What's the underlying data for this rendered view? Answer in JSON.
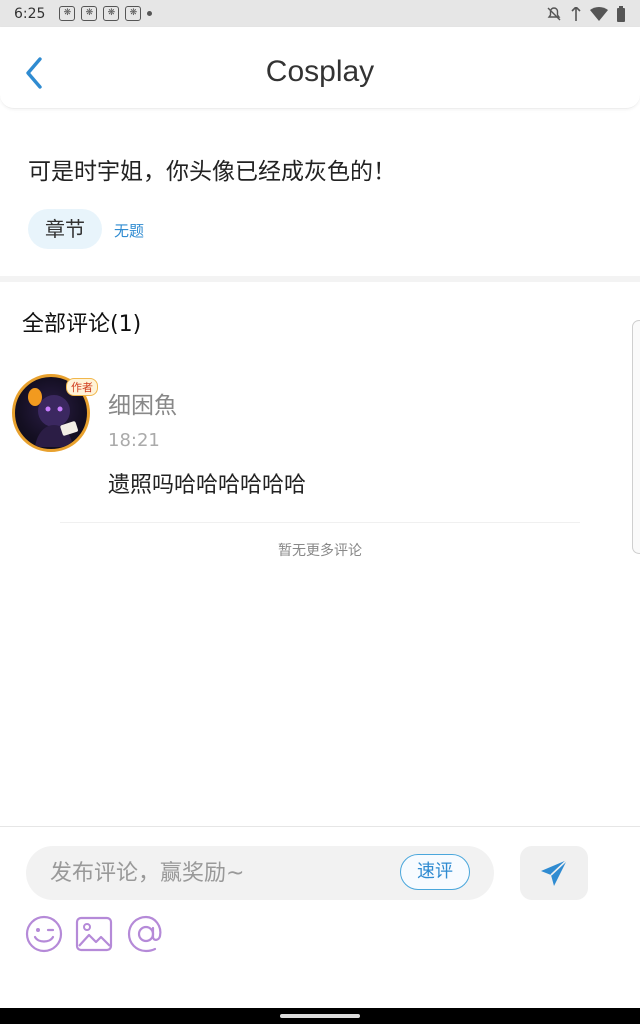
{
  "status_bar": {
    "time": "6:25",
    "notification_icons": [
      "paw-notification-icon",
      "paw-notification-icon",
      "paw-notification-icon",
      "paw-notification-icon"
    ]
  },
  "header": {
    "title": "Cosplay"
  },
  "post": {
    "text": "可是时宇姐，你头像已经成灰色的！",
    "chapter_tag": "章节",
    "chapter_name": "无题"
  },
  "comments": {
    "title": "全部评论(1)",
    "items": [
      {
        "avatar_badge": "作者",
        "username": "细困魚",
        "time": "18:21",
        "text": "遗照吗哈哈哈哈哈哈"
      }
    ],
    "no_more": "暂无更多评论"
  },
  "composer": {
    "placeholder": "发布评论，赢奖励~",
    "quick_label": "速评",
    "tools": [
      "emoji-icon",
      "image-icon",
      "at-icon"
    ]
  },
  "colors": {
    "accent": "#2f8bd1",
    "tool_purple": "#b58ad8"
  }
}
